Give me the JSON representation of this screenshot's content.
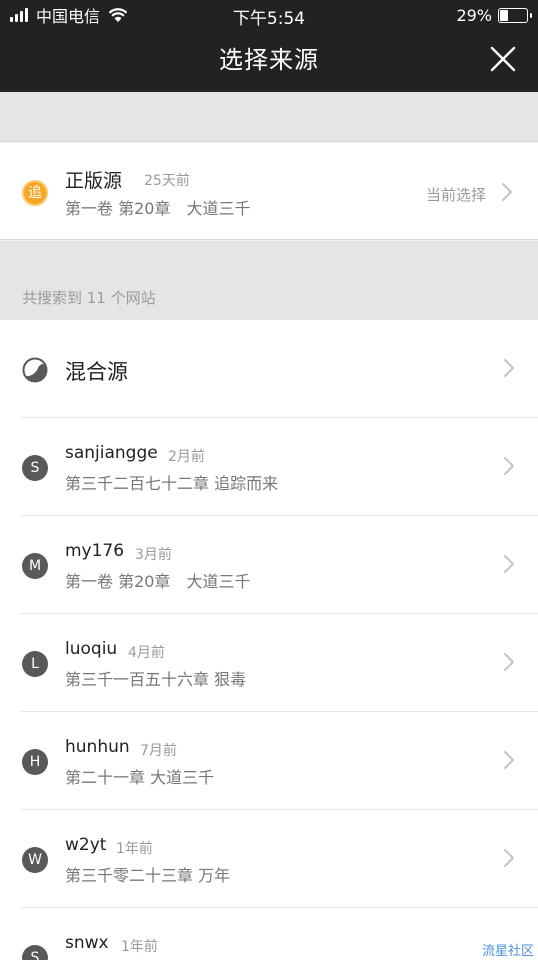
{
  "status": {
    "carrier": "中国电信",
    "time": "下午5:54",
    "battery": "29%",
    "battery_level": 0.29
  },
  "nav": {
    "title": "选择来源"
  },
  "current_source": {
    "icon_char": "追",
    "name": "正版源",
    "time": "25天前",
    "chapter": "第一卷 第20章　大道三千",
    "label": "当前选择"
  },
  "search_count_text": "共搜索到 11 个网站",
  "mixed": {
    "name": "混合源"
  },
  "sources": [
    {
      "letter": "S",
      "name": "sanjiangge",
      "time": "2月前",
      "chapter": "第三千二百七十二章 追踪而来"
    },
    {
      "letter": "M",
      "name": "my176",
      "time": "3月前",
      "chapter": "第一卷 第20章　大道三千"
    },
    {
      "letter": "L",
      "name": "luoqiu",
      "time": "4月前",
      "chapter": "第三千一百五十六章 狠毒"
    },
    {
      "letter": "H",
      "name": "hunhun",
      "time": "7月前",
      "chapter": "第二十一章 大道三千"
    },
    {
      "letter": "W",
      "name": "w2yt",
      "time": "1年前",
      "chapter": "第三千零二十三章 万年"
    },
    {
      "letter": "S",
      "name": "snwx",
      "time": "1年前",
      "chapter": ""
    }
  ],
  "watermark": "流星社区",
  "colors": {
    "nav_bg": "#222222",
    "icon_orange": "#f6a623",
    "letter_bg": "#595959"
  }
}
